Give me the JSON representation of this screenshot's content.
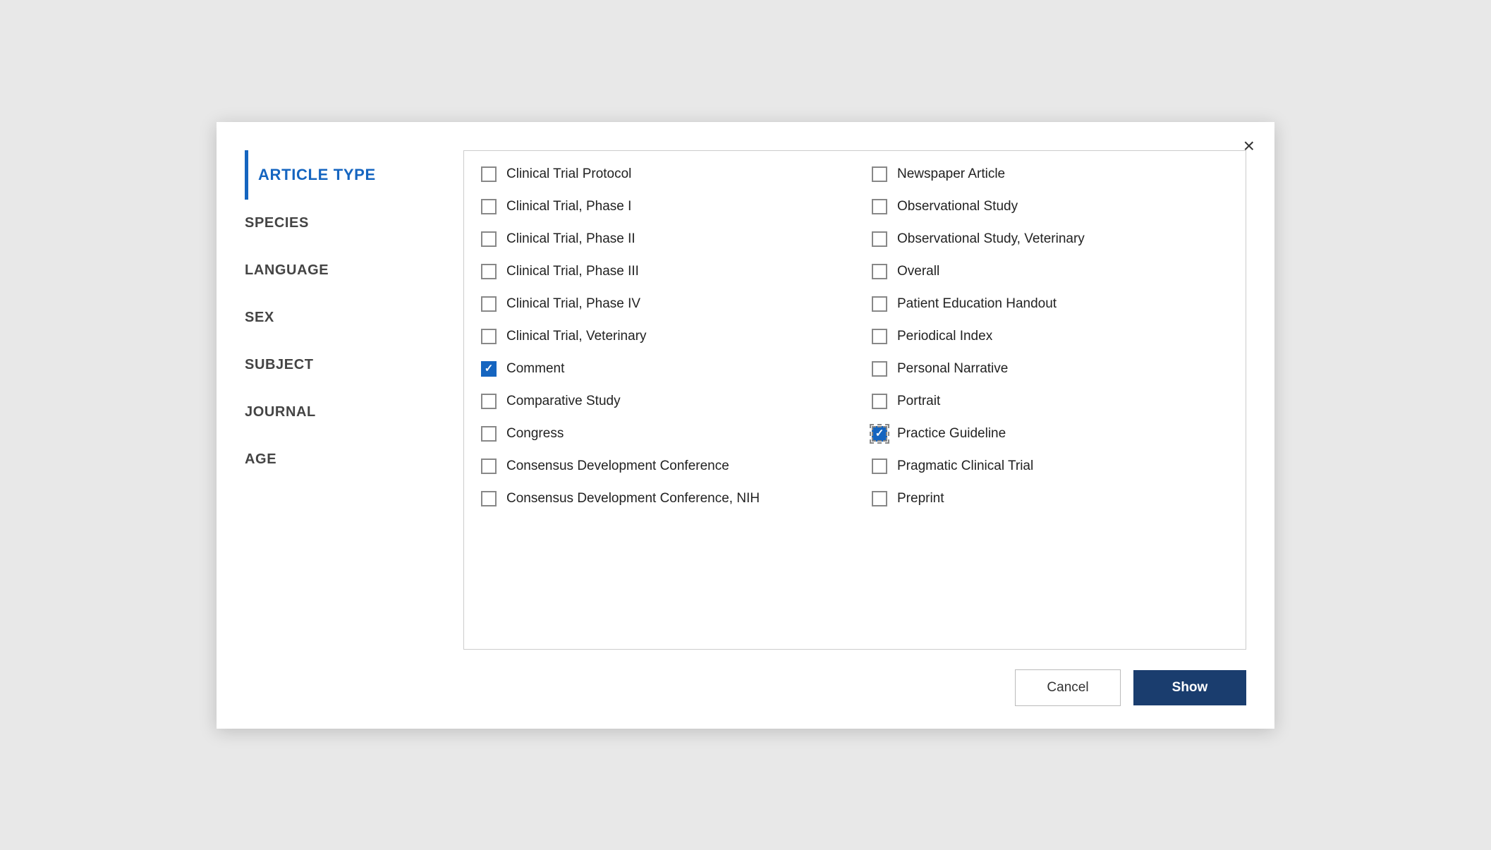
{
  "dialog": {
    "title": "ARTICLE TYPE",
    "close_label": "×"
  },
  "sidebar": {
    "items": [
      {
        "id": "article-type",
        "label": "ARTICLE TYPE",
        "active": true
      },
      {
        "id": "species",
        "label": "SPECIES",
        "active": false
      },
      {
        "id": "language",
        "label": "LANGUAGE",
        "active": false
      },
      {
        "id": "sex",
        "label": "SEX",
        "active": false
      },
      {
        "id": "subject",
        "label": "SUBJECT",
        "active": false
      },
      {
        "id": "journal",
        "label": "JOURNAL",
        "active": false
      },
      {
        "id": "age",
        "label": "AGE",
        "active": false
      }
    ]
  },
  "list": {
    "columns": [
      [
        {
          "id": "clinical-trial-protocol",
          "label": "Clinical Trial Protocol",
          "checked": false,
          "focused": false
        },
        {
          "id": "clinical-trial-phase-i",
          "label": "Clinical Trial, Phase I",
          "checked": false,
          "focused": false
        },
        {
          "id": "clinical-trial-phase-ii",
          "label": "Clinical Trial, Phase II",
          "checked": false,
          "focused": false
        },
        {
          "id": "clinical-trial-phase-iii",
          "label": "Clinical Trial, Phase III",
          "checked": false,
          "focused": false
        },
        {
          "id": "clinical-trial-phase-iv",
          "label": "Clinical Trial, Phase IV",
          "checked": false,
          "focused": false
        },
        {
          "id": "clinical-trial-veterinary",
          "label": "Clinical Trial, Veterinary",
          "checked": false,
          "focused": false
        },
        {
          "id": "comment",
          "label": "Comment",
          "checked": true,
          "focused": false
        },
        {
          "id": "comparative-study",
          "label": "Comparative Study",
          "checked": false,
          "focused": false
        },
        {
          "id": "congress",
          "label": "Congress",
          "checked": false,
          "focused": false
        },
        {
          "id": "consensus-dev-conf",
          "label": "Consensus Development Conference",
          "checked": false,
          "focused": false
        },
        {
          "id": "consensus-dev-conf-nih",
          "label": "Consensus Development Conference, NIH",
          "checked": false,
          "focused": false
        }
      ],
      [
        {
          "id": "newspaper-article",
          "label": "Newspaper Article",
          "checked": false,
          "focused": false
        },
        {
          "id": "observational-study",
          "label": "Observational Study",
          "checked": false,
          "focused": false
        },
        {
          "id": "observational-study-vet",
          "label": "Observational Study, Veterinary",
          "checked": false,
          "focused": false
        },
        {
          "id": "overall",
          "label": "Overall",
          "checked": false,
          "focused": false
        },
        {
          "id": "patient-education-handout",
          "label": "Patient Education Handout",
          "checked": false,
          "focused": false
        },
        {
          "id": "periodical-index",
          "label": "Periodical Index",
          "checked": false,
          "focused": false
        },
        {
          "id": "personal-narrative",
          "label": "Personal Narrative",
          "checked": false,
          "focused": false
        },
        {
          "id": "portrait",
          "label": "Portrait",
          "checked": false,
          "focused": false
        },
        {
          "id": "practice-guideline",
          "label": "Practice Guideline",
          "checked": true,
          "focused": true
        },
        {
          "id": "pragmatic-clinical-trial",
          "label": "Pragmatic Clinical Trial",
          "checked": false,
          "focused": false
        },
        {
          "id": "preprint",
          "label": "Preprint",
          "checked": false,
          "focused": false
        }
      ]
    ]
  },
  "footer": {
    "cancel_label": "Cancel",
    "show_label": "Show"
  }
}
